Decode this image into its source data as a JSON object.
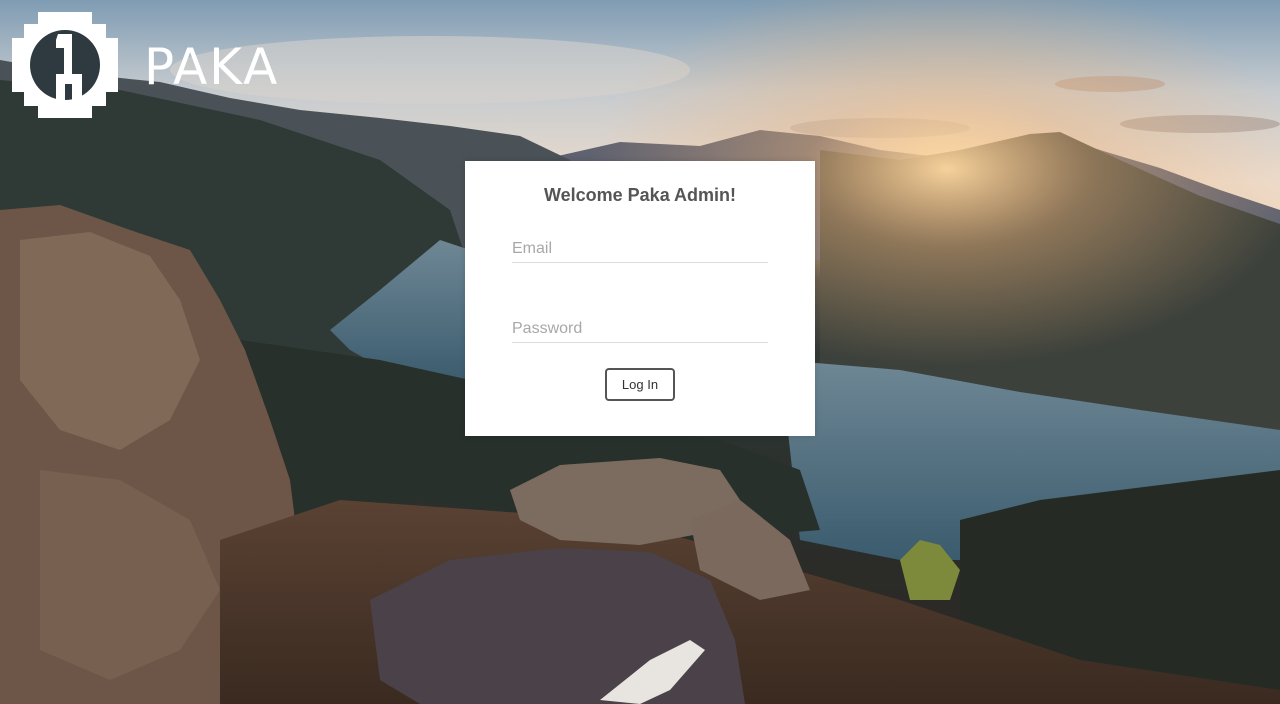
{
  "brand": {
    "name": "PAKA",
    "logo_icon": "paka-logo-icon"
  },
  "login": {
    "title": "Welcome Paka Admin!",
    "email_placeholder": "Email",
    "email_value": "",
    "password_placeholder": "Password",
    "password_value": "",
    "submit_label": "Log In"
  },
  "colors": {
    "card_background": "#ffffff",
    "title_text": "#555555",
    "button_border": "#555555",
    "placeholder_text": "#a8a8a8"
  }
}
